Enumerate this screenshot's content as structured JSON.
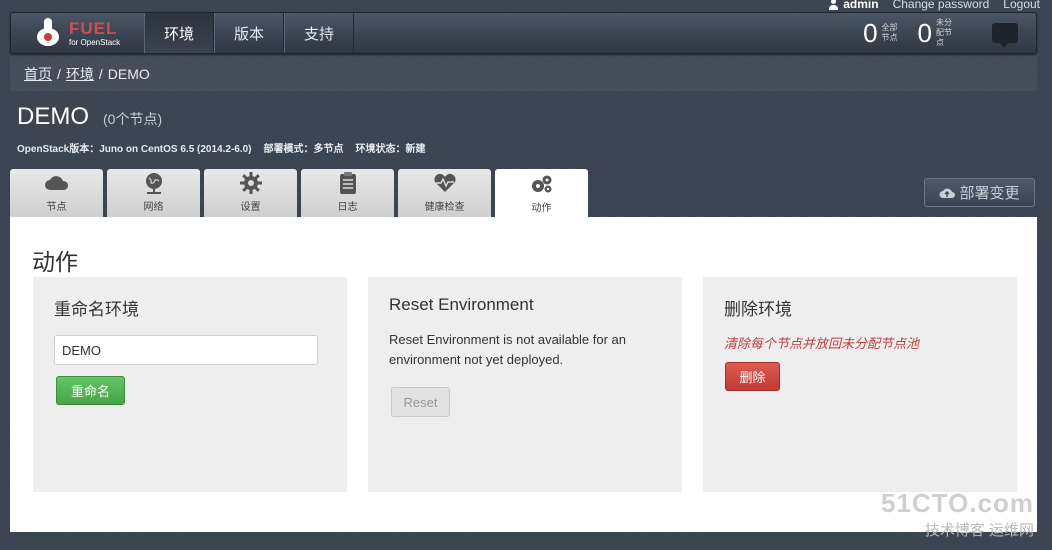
{
  "user": {
    "name": "admin",
    "change_password": "Change password",
    "logout": "Logout"
  },
  "brand": {
    "name": "FUEL",
    "sub": "for OpenStack",
    "color": "#d64b4b"
  },
  "nav": {
    "items": [
      "环境",
      "版本",
      "支持"
    ]
  },
  "stats": [
    {
      "value": "0",
      "label": "全部节点"
    },
    {
      "value": "0",
      "label": "未分配节点"
    }
  ],
  "breadcrumb": {
    "home": "首页",
    "sep": "/",
    "env": "环境",
    "current": "DEMO"
  },
  "environment": {
    "name": "DEMO",
    "node_count": "(0个节点)",
    "openstack_label": "OpenStack版本：",
    "openstack_value": "Juno on CentOS 6.5 (2014.2-6.0)",
    "mode_label": "部署模式：",
    "mode_value": "多节点",
    "status_label": "环境状态：",
    "status_value": "新建"
  },
  "tabs": [
    {
      "label": "节点",
      "icon": "cloud-icon"
    },
    {
      "label": "网络",
      "icon": "globe-icon"
    },
    {
      "label": "设置",
      "icon": "gear-icon"
    },
    {
      "label": "日志",
      "icon": "clipboard-icon"
    },
    {
      "label": "健康检查",
      "icon": "heart-icon"
    },
    {
      "label": "动作",
      "icon": "gears-icon"
    }
  ],
  "deploy_button": "部署变更",
  "actions": {
    "title": "动作",
    "rename": {
      "title": "重命名环境",
      "value": "DEMO",
      "button": "重命名"
    },
    "reset": {
      "title": "Reset Environment",
      "desc": "Reset Environment is not available for an environment not yet deployed.",
      "button": "Reset"
    },
    "delete": {
      "title": "删除环境",
      "warning": "清除每个节点并放回未分配节点池",
      "button": "删除"
    }
  },
  "watermark": {
    "line1": "51CTO.com",
    "line2": "技术博客 运维网"
  },
  "colors": {
    "accent_green": "#5bb75b",
    "danger_red": "#d9534f",
    "warning_text": "#c0413c"
  }
}
